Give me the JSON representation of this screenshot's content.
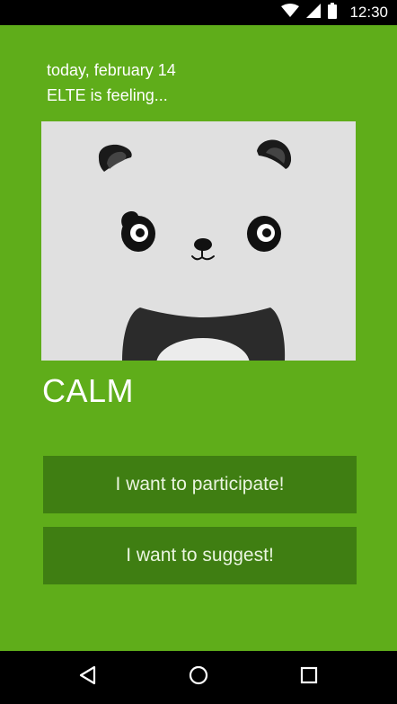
{
  "status_bar": {
    "time": "12:30",
    "icons": [
      "wifi-icon",
      "signal-icon",
      "battery-icon"
    ]
  },
  "header": {
    "date": "today, february 14",
    "feeling": "ELTE is feeling..."
  },
  "mood": {
    "label": "CALM",
    "image": "panda-face"
  },
  "actions": {
    "participate_label": "I want to participate!",
    "suggest_label": "I want to suggest!"
  },
  "nav_bar": {
    "icons": [
      "back-icon",
      "home-icon",
      "recents-icon"
    ]
  },
  "colors": {
    "background": "#5fad1a",
    "button": "#3f7e12",
    "card": "#e0e0e0",
    "bars": "#000000"
  }
}
